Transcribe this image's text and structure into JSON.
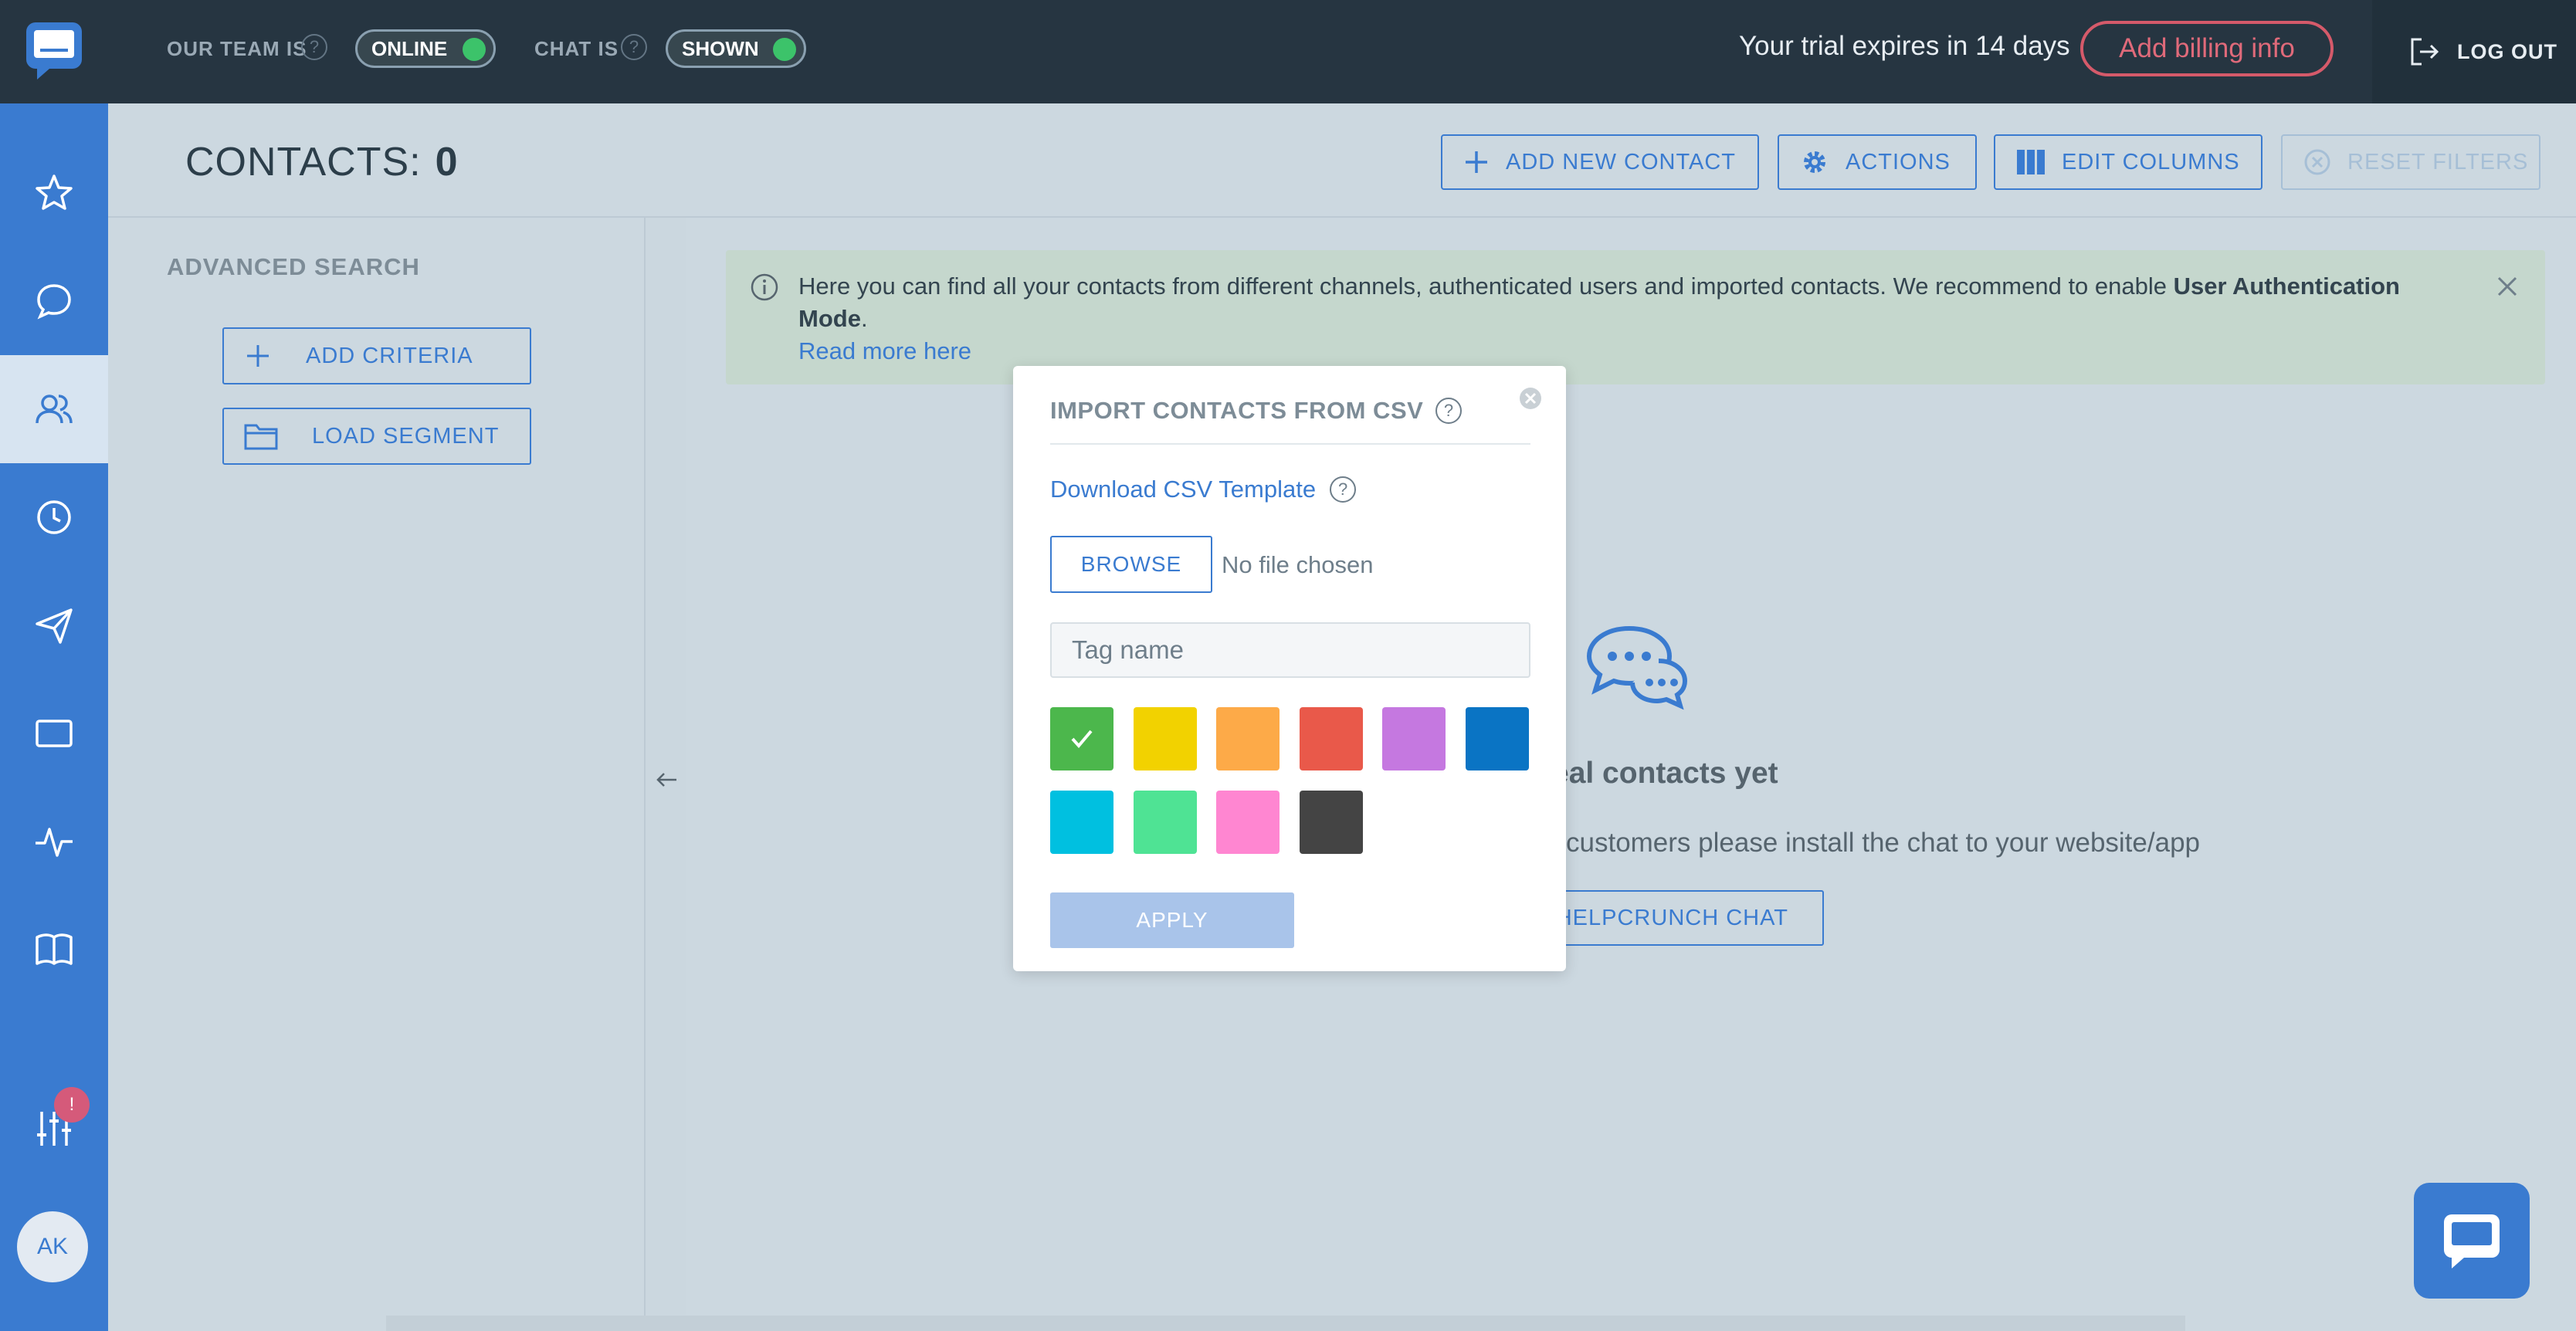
{
  "topbar": {
    "team_label": "OUR TEAM IS",
    "team_status": "ONLINE",
    "chat_label": "CHAT IS",
    "chat_status": "SHOWN",
    "help_glyph": "?",
    "trial_text": "Your trial expires in 14 days",
    "billing_label": "Add billing info",
    "logout_label": "LOG OUT"
  },
  "sidebar": {
    "items": [
      {
        "icon": "star-icon"
      },
      {
        "icon": "chat-bubble-icon"
      },
      {
        "icon": "contacts-icon"
      },
      {
        "icon": "clock-icon"
      },
      {
        "icon": "send-icon"
      },
      {
        "icon": "window-icon"
      },
      {
        "icon": "pulse-icon"
      },
      {
        "icon": "book-icon"
      },
      {
        "icon": "sliders-icon"
      }
    ],
    "badge": "!",
    "avatar": "AK"
  },
  "header": {
    "title": "CONTACTS:",
    "count": "0",
    "add_contact": "ADD NEW CONTACT",
    "actions": "ACTIONS",
    "edit_columns": "EDIT COLUMNS",
    "reset_filters": "RESET FILTERS"
  },
  "left_panel": {
    "title": "ADVANCED SEARCH",
    "add_criteria": "ADD CRITERIA",
    "load_segment": "LOAD SEGMENT"
  },
  "banner": {
    "text_before": "Here you can find all your contacts from different channels, authenticated users and imported contacts. We recommend to enable ",
    "text_bold": "User Authentication Mode",
    "text_after": ".",
    "link": "Read more here"
  },
  "empty_state": {
    "title": "eal contacts yet",
    "subtitle": "customers please install the chat to your website/app",
    "button": "L HELPCRUNCH CHAT"
  },
  "modal": {
    "title": "IMPORT CONTACTS FROM CSV",
    "download_link": "Download CSV Template",
    "browse": "BROWSE",
    "no_file": "No file chosen",
    "tag_placeholder": "Tag name",
    "colors": [
      "#4cb74c",
      "#f2d200",
      "#fdaa48",
      "#e9594a",
      "#c578e0",
      "#0a74c4",
      "#00c0e0",
      "#4fe394",
      "#ff86d1",
      "#444444"
    ],
    "selected_color_index": 0,
    "apply": "APPLY"
  },
  "colors": {
    "brand": "#3a7bd0",
    "topbar": "#263541",
    "billing": "#d55a6a",
    "status_dot": "#3cc36a"
  }
}
